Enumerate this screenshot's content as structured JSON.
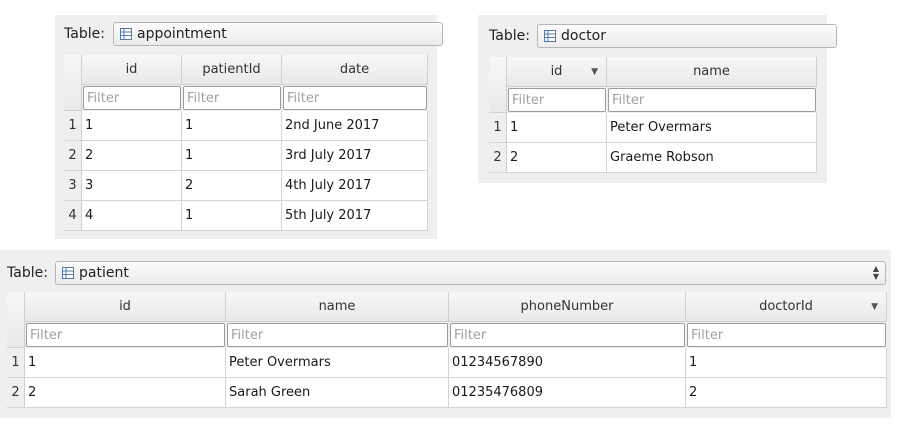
{
  "appointment": {
    "table_label": "Table:",
    "table_name": "appointment",
    "columns": [
      "id",
      "patientId",
      "date"
    ],
    "filter_placeholder": "Filter",
    "rows": [
      {
        "row": "1",
        "cells": [
          "1",
          "1",
          "2nd June 2017"
        ]
      },
      {
        "row": "2",
        "cells": [
          "2",
          "1",
          "3rd July 2017"
        ]
      },
      {
        "row": "3",
        "cells": [
          "3",
          "2",
          "4th July 2017"
        ]
      },
      {
        "row": "4",
        "cells": [
          "4",
          "1",
          "5th July 2017"
        ]
      }
    ]
  },
  "doctor": {
    "table_label": "Table:",
    "table_name": "doctor",
    "columns": [
      "id",
      "name"
    ],
    "sorted_column": "id",
    "filter_placeholder": "Filter",
    "rows": [
      {
        "row": "1",
        "cells": [
          "1",
          "Peter Overmars"
        ]
      },
      {
        "row": "2",
        "cells": [
          "2",
          "Graeme Robson"
        ]
      }
    ]
  },
  "patient": {
    "table_label": "Table:",
    "table_name": "patient",
    "columns": [
      "id",
      "name",
      "phoneNumber",
      "doctorId"
    ],
    "sorted_column": "doctorId",
    "filter_placeholder": "Filter",
    "rows": [
      {
        "row": "1",
        "cells": [
          "1",
          "Peter Overmars",
          "01234567890",
          "1"
        ]
      },
      {
        "row": "2",
        "cells": [
          "2",
          "Sarah Green",
          "01235476809",
          "2"
        ]
      }
    ]
  },
  "icons": {
    "table_icon": "table-icon",
    "sort_indicator": "sort-down-icon",
    "combo_spinner": "spinner-arrows-icon"
  }
}
